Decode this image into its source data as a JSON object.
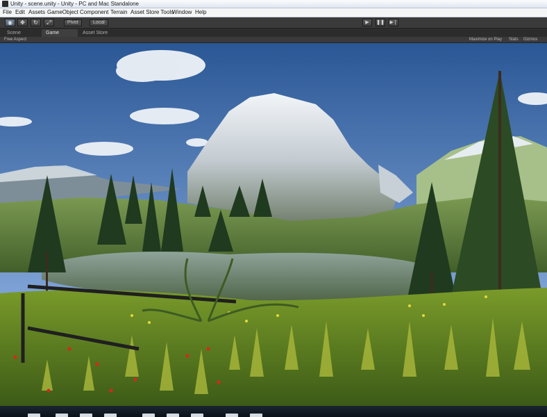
{
  "window": {
    "title": "Unity - scene.unity - Unity - PC and Mac Standalone"
  },
  "menu": [
    "File",
    "Edit",
    "Assets",
    "GameObject",
    "Component",
    "Terrain",
    "Asset Store Tools",
    "Window",
    "Help"
  ],
  "toolbar": {
    "pivot_label": "Pivot",
    "local_label": "Local",
    "play_icon": "play-icon",
    "pause_icon": "pause-icon",
    "step_icon": "step-icon"
  },
  "tabs": [
    "Scene",
    "Game",
    "Asset Store"
  ],
  "game_bar": {
    "aspect": "Free Aspect",
    "maximize_on_play": "Maximize on Play",
    "stats": "Stats",
    "gizmos": "Gizmos"
  },
  "colors": {
    "sky_top": "#2f5f9e",
    "sky_bottom": "#9bbbe0",
    "grass": "#6b8f2a",
    "editor_dark": "#3a3a3a"
  }
}
